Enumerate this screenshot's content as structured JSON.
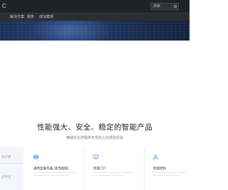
{
  "header": {
    "logo_glyph": "C",
    "search_placeholder": "搜索"
  },
  "nav": {
    "items": [
      {
        "label": "解决方案"
      },
      {
        "label": "服务"
      },
      {
        "label": "成功案例"
      }
    ]
  },
  "hero": {
    "title": "性能强大、安全、稳定的智能产品",
    "subtitle": "精通云为您提供无忧的上云体验机会"
  },
  "products": {
    "menu": [
      {
        "label": "云计算"
      },
      {
        "label": "云平台"
      }
    ],
    "cards": [
      {
        "title": "通用型服务器 (高性能版)",
        "icon": "cloud-server-icon",
        "icon_color": "#2f80ed"
      },
      {
        "title": "智能门户",
        "icon": "portal-icon",
        "icon_color": "#3b82f6"
      },
      {
        "title": "智能结构",
        "icon": "structure-icon",
        "icon_color": "#2f80ed"
      }
    ]
  },
  "colors": {
    "header_bg": "#1f2328",
    "nav_bg": "#2a2e33",
    "accent": "#2f80ed"
  }
}
